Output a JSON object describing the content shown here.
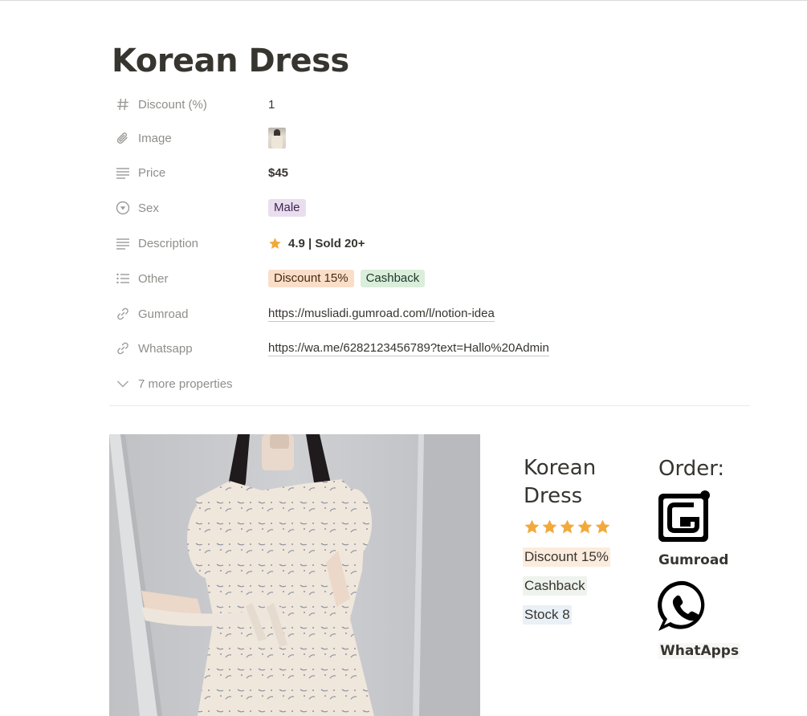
{
  "page": {
    "title": "Korean Dress"
  },
  "properties": [
    {
      "icon": "hash-icon",
      "name": "Discount (%)",
      "value": "1"
    },
    {
      "icon": "paperclip-icon",
      "name": "Image",
      "value": ""
    },
    {
      "icon": "text-lines-icon",
      "name": "Price",
      "value": "$45"
    },
    {
      "icon": "select-circle-icon",
      "name": "Sex",
      "value": "Male"
    },
    {
      "icon": "text-lines-icon",
      "name": "Description",
      "value": "4.9 | Sold 20+"
    },
    {
      "icon": "bullet-list-icon",
      "name": "Other",
      "tags": [
        "Discount 15%",
        "Cashback"
      ]
    },
    {
      "icon": "link-icon",
      "name": "Gumroad",
      "value": "https://musliadi.gumroad.com/l/notion-idea"
    },
    {
      "icon": "link-icon",
      "name": "Whatsapp",
      "value": "https://wa.me/6282123456789?text=Hallo%20Admin"
    }
  ],
  "more_properties": "7 more properties",
  "product_card": {
    "name_line1": "Korean",
    "name_line2": "Dress",
    "rating_stars": 5,
    "tags": [
      "Discount 15%",
      "Cashback",
      "Stock 8"
    ]
  },
  "order": {
    "title": "Order:",
    "gumroad_label": "Gumroad",
    "whatsapp_label": "WhatApps"
  },
  "colors": {
    "star": "#f2a93b",
    "tag_purple": "#e8deee",
    "tag_orange": "#fadec9",
    "tag_green": "#dbeddb"
  }
}
